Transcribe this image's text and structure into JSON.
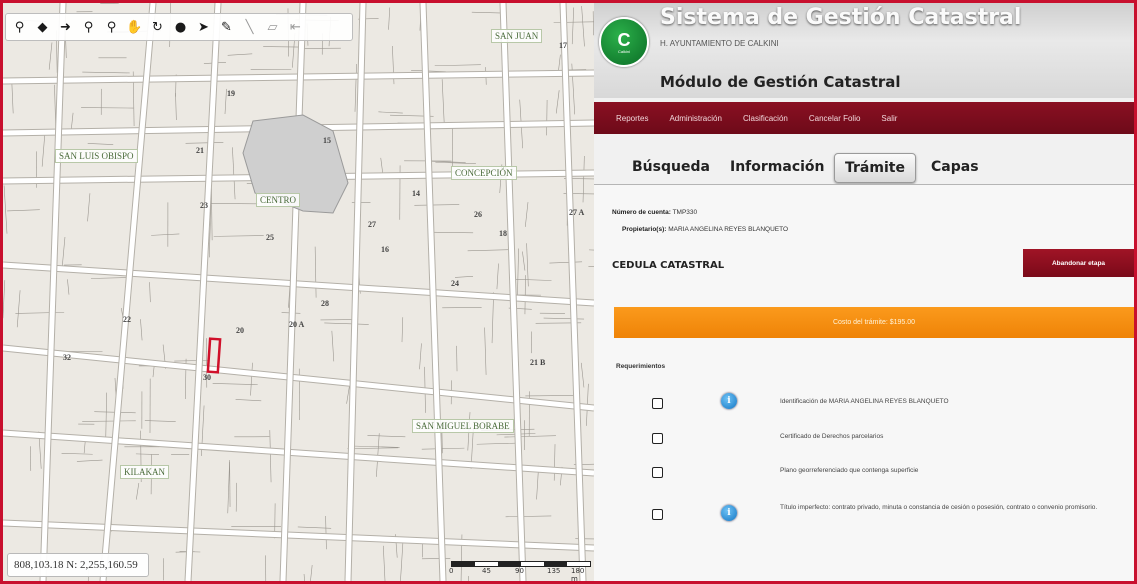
{
  "map": {
    "toolbar": [
      {
        "name": "identify-icon",
        "glyph": "⚲"
      },
      {
        "name": "pan-left-icon",
        "glyph": "◆"
      },
      {
        "name": "pan-right-icon",
        "glyph": "➜"
      },
      {
        "name": "zoom-in-icon",
        "glyph": "⚲"
      },
      {
        "name": "zoom-out-icon",
        "glyph": "⚲"
      },
      {
        "name": "hand-pan-icon",
        "glyph": "✋"
      },
      {
        "name": "refresh-icon",
        "glyph": "↻"
      },
      {
        "name": "globe-icon",
        "glyph": "●"
      },
      {
        "name": "select-arrow-icon",
        "glyph": "➤"
      },
      {
        "name": "draw-point-icon",
        "glyph": "✎"
      },
      {
        "name": "draw-line-icon",
        "glyph": "╲"
      },
      {
        "name": "draw-polygon-icon",
        "glyph": "▱"
      },
      {
        "name": "clear-icon",
        "glyph": "⇤"
      }
    ],
    "coords": "808,103.18 N: 2,255,160.59",
    "neighborhoods": [
      "SAN JUAN",
      "SAN LUIS OBISPO",
      "CONCEPCIÓN",
      "CENTRO",
      "SAN MIGUEL BORABE",
      "KILAKAN"
    ],
    "scale_labels": [
      "0",
      "45",
      "90",
      "135",
      "180 m"
    ],
    "street_numbers": [
      "17",
      "21",
      "23",
      "25",
      "27",
      "19",
      "15",
      "24",
      "26",
      "18",
      "20",
      "22",
      "32",
      "30",
      "28",
      "16",
      "14",
      "21 B",
      "20 A",
      "27 A"
    ]
  },
  "header": {
    "logo_letter": "C",
    "logo_text": "Calkini",
    "title": "Sistema de Gestión Catastral",
    "subtitle": "H. AYUNTAMIENTO DE CALKINI",
    "module": "Módulo de Gestión Catastral"
  },
  "nav": [
    "Reportes",
    "Administración",
    "Clasificación",
    "Cancelar Folio",
    "Salir"
  ],
  "tabs": [
    "Búsqueda",
    "Información",
    "Trámite",
    "Capas"
  ],
  "active_tab": "Trámite",
  "tramite": {
    "account_label": "Número de cuenta:",
    "account_value": "TMP330",
    "owner_label": "Propietario(s):",
    "owner_value": "MARIA ANGELINA REYES BLANQUETO",
    "section_title": "CEDULA CATASTRAL",
    "abandon_button": "Abandonar etapa",
    "cost": "Costo del trámite: $195.00",
    "requirements_title": "Requerimientos",
    "requirements": [
      {
        "text": "Identificación de MARIA ANGELINA REYES BLANQUETO",
        "info": true
      },
      {
        "text": "Certificado de Derechos parcelarios",
        "info": false
      },
      {
        "text": "Plano georreferenciado que contenga superficie",
        "info": false
      },
      {
        "text": "Título imperfecto: contrato privado, minuta o constancia de cesión o posesión, contrato o convenio promisorio.",
        "info": true
      }
    ]
  },
  "colors": {
    "frame": "#c8102e",
    "nav_bg": "#7a0a19",
    "cost_bar": "#f48a0e",
    "logo_green": "#128a33",
    "info_blue": "#1476c4",
    "parcel_red": "#d0102a"
  }
}
